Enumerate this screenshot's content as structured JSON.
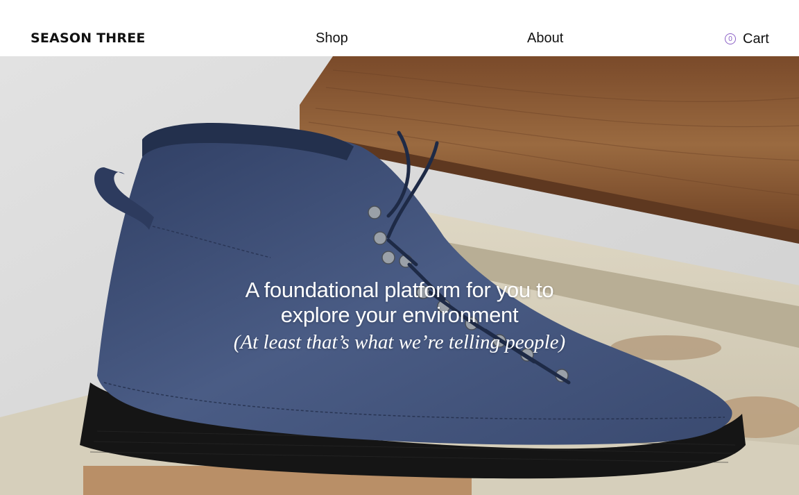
{
  "header": {
    "logo": "SEASON THREE",
    "nav": {
      "shop": "Shop",
      "about": "About"
    },
    "cart": {
      "count": "0",
      "label": "Cart"
    }
  },
  "hero": {
    "headline_line1": "A foundational platform for you to",
    "headline_line2": "explore your environment",
    "subline": "(At least that’s what we’re telling people)",
    "image": "navy-suede-hiking-boot-on-wooden-drawer",
    "colors": {
      "wall": "#dcdcdc",
      "boot": "#3c4d75",
      "sole": "#151515",
      "wood": "#8a5a34",
      "drawer": "#d8d1bd"
    }
  }
}
